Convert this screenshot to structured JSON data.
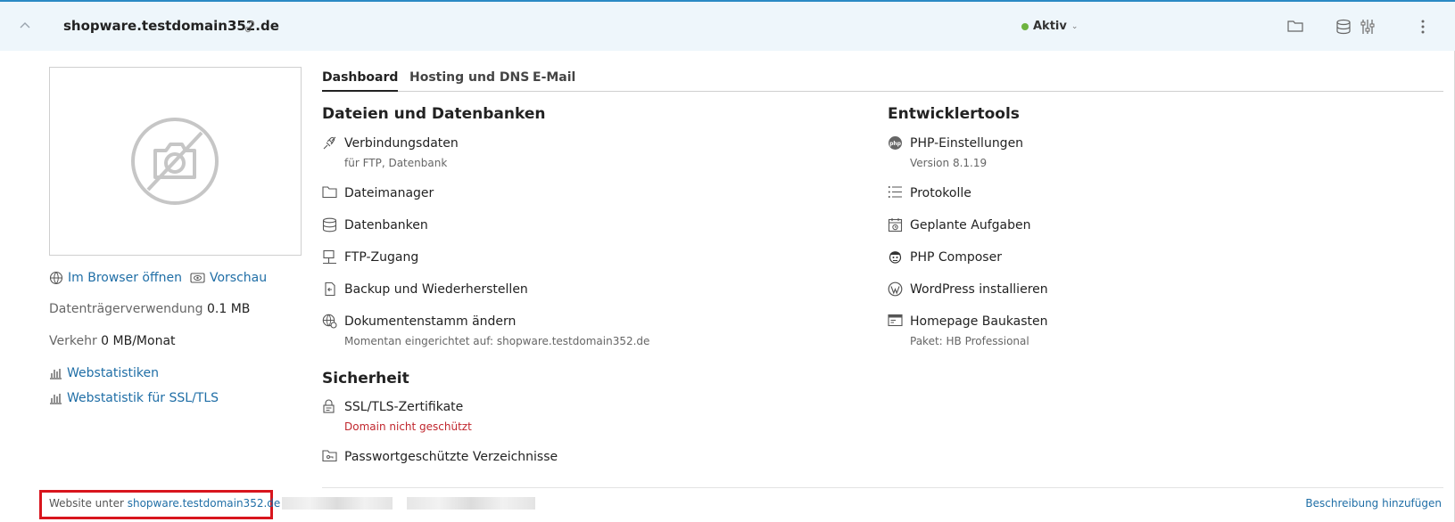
{
  "header": {
    "domain": "shopware.testdomain352.de",
    "status": "Aktiv"
  },
  "sidebar": {
    "open_browser": "Im Browser öffnen",
    "preview": "Vorschau",
    "disk_label": "Datenträgerverwendung",
    "disk_value": "0.1 MB",
    "traffic_label": "Verkehr",
    "traffic_value": "0 MB/Monat",
    "stats": "Webstatistiken",
    "stats_ssl": "Webstatistik für SSL/TLS"
  },
  "tabs": [
    "Dashboard",
    "Hosting und DNS",
    "E-Mail"
  ],
  "files": {
    "title": "Dateien und Datenbanken",
    "items": [
      {
        "label": "Verbindungsdaten",
        "sub": "für FTP, Datenbank"
      },
      {
        "label": "Dateimanager"
      },
      {
        "label": "Datenbanken"
      },
      {
        "label": "FTP-Zugang"
      },
      {
        "label": "Backup und Wiederherstellen"
      },
      {
        "label": "Dokumentenstamm ändern",
        "sub": "Momentan eingerichtet auf: shopware.testdomain352.de"
      }
    ]
  },
  "security": {
    "title": "Sicherheit",
    "items": [
      {
        "label": "SSL/TLS-Zertifikate",
        "sub": "Domain nicht geschützt"
      },
      {
        "label": "Passwortgeschützte Verzeichnisse"
      }
    ]
  },
  "devtools": {
    "title": "Entwicklertools",
    "items": [
      {
        "label": "PHP-Einstellungen",
        "sub": "Version 8.1.19"
      },
      {
        "label": "Protokolle"
      },
      {
        "label": "Geplante Aufgaben"
      },
      {
        "label": "PHP Composer"
      },
      {
        "label": "WordPress installieren"
      },
      {
        "label": "Homepage Baukasten",
        "sub": "Paket: HB Professional"
      }
    ]
  },
  "footer": {
    "prefix": "Website unter",
    "link": "shopware.testdomain352.de",
    "add_description": "Beschreibung hinzufügen"
  },
  "colors": {
    "accent": "#1f6ea6",
    "status_ok": "#6db33f",
    "warning": "#c0262d",
    "highlight_box": "#d8151d"
  }
}
